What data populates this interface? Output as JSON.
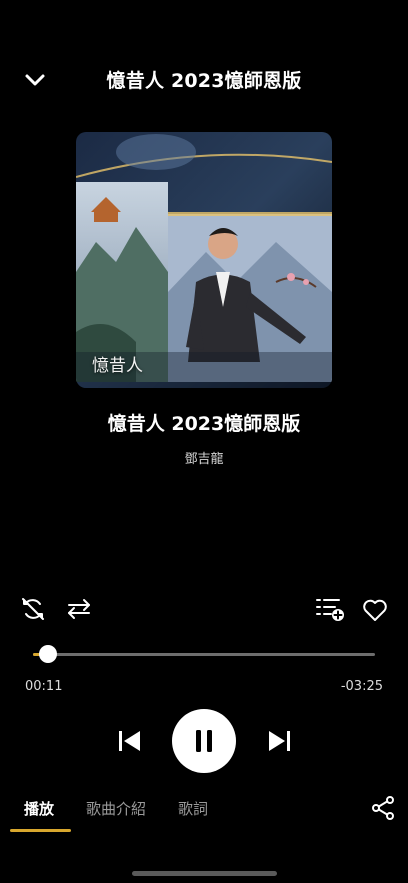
{
  "header": {
    "title": "憶昔人 2023憶師恩版"
  },
  "album": {
    "art_text": "憶昔人"
  },
  "song": {
    "title": "憶昔人 2023憶師恩版",
    "artist": "鄧吉龍"
  },
  "progress": {
    "elapsed": "00:11",
    "remaining": "-03:25",
    "fraction": 0.045
  },
  "tabs": [
    {
      "label": "播放",
      "active": true
    },
    {
      "label": "歌曲介紹",
      "active": false
    },
    {
      "label": "歌詞",
      "active": false
    }
  ],
  "colors": {
    "accent": "#d8a72e",
    "background": "#000000"
  },
  "icons": [
    "chevron-down-icon",
    "shuffle-off-icon",
    "repeat-icon",
    "add-to-playlist-icon",
    "heart-icon",
    "previous-icon",
    "pause-icon",
    "next-icon",
    "share-icon"
  ]
}
